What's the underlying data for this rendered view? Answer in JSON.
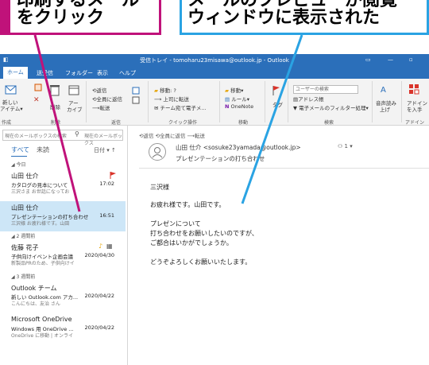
{
  "callouts": {
    "left": [
      "印刷するメール",
      "をクリック"
    ],
    "right": [
      "メールのプレビューが閲覧",
      "ウィンドウに表示された"
    ]
  },
  "titlebar": {
    "title": "受信トレイ - tomoharu23misawa@outlook.jp - Outlook"
  },
  "menu": [
    "ホーム",
    "送受信",
    "フォルダー",
    "表示",
    "ヘルプ"
  ],
  "ribbon": {
    "new_item": [
      "新しい",
      "アイテム▾"
    ],
    "delete": "削除",
    "archive": [
      "アー",
      "カイブ"
    ],
    "reply": "返信",
    "reply_all": "全員に返信",
    "forward": "転送",
    "move_to": "移動: ?",
    "to_manager": "上司に転送",
    "team_mail": "チーム宛て電子メ...",
    "move": "移動▾",
    "rules": "ルール▾",
    "onenote": "OneNote",
    "tag": "タグ",
    "search_people": "ユーザーの検索",
    "address_book": "アドレス帳",
    "filter_mail": "電子メールのフィルター処理▾",
    "read_aloud": [
      "音声読み",
      "上げ"
    ],
    "addin": [
      "アドイン",
      "を入手"
    ],
    "groups": {
      "new": "作成",
      "delete": "削除",
      "respond": "返信",
      "quick_steps": "クイック操作",
      "move": "移動",
      "find": "検索",
      "addin": "アドイン"
    }
  },
  "left_pane": {
    "search_placeholder": "現在のメールボックスの検索",
    "scope": "現在のメールボックス",
    "tab_all": "すべて",
    "tab_unread": "未読",
    "sort": "日付 ▾  ↑",
    "sections": {
      "today": "◢ 今日",
      "two_weeks": "◢ 2 週間前",
      "three_weeks": "◢ 3 週間前"
    },
    "mails": [
      {
        "from": "山田 仕介",
        "subject": "カタログの見本について",
        "preview": "三沢さま  お世話になってお",
        "date": "17:02"
      },
      {
        "from": "山田 仕介",
        "subject": "プレゼンテーションの打ち合わせ",
        "preview": "三沢様  お疲れ様です。山田",
        "date": "16:51"
      },
      {
        "from": "佐藤 花子",
        "subject": "子供向けイベント企画会議",
        "preview": "新製品PRのため、子供向けイ",
        "date": "2020/04/30"
      },
      {
        "from": "Outlook チーム",
        "subject": "新しい Outlook.com アカ...",
        "preview": "こんにちは、友治 さん",
        "date": "2020/04/22"
      },
      {
        "from": "Microsoft OneDrive",
        "subject": "Windows 用 OneDrive ...",
        "preview": "OneDrive に移動 | オンライ",
        "date": "2020/04/22"
      }
    ]
  },
  "reading": {
    "actions": "⟲返信  ⟲全員に返信  ⟶転送",
    "sender": "山田 仕介 <sosuke23yamada@outlook.jp>",
    "recipients": "1 ▾",
    "subject": "プレゼンテーションの打ち合わせ",
    "body": [
      "三沢様",
      "お疲れ様です。山田です。",
      "プレゼンについて",
      "打ち合わせをお願いしたいのですが、",
      "ご都合はいかがでしょうか。",
      "どうぞよろしくお願いいたします。"
    ]
  }
}
